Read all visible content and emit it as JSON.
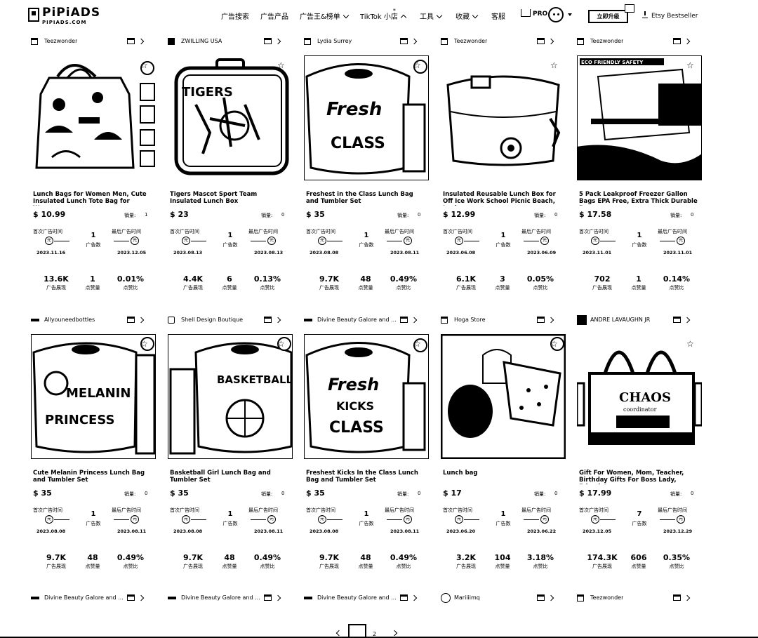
{
  "brand": {
    "name": "PiPiADS",
    "sub": "PIPIADS.COM"
  },
  "nav": [
    {
      "label": "广告搜索"
    },
    {
      "label": "广告产品"
    },
    {
      "label": "广告王&榜单"
    },
    {
      "label": "TikTok 小店",
      "badge": "*"
    },
    {
      "label": "工具"
    },
    {
      "label": "收藏"
    },
    {
      "label": "客服"
    }
  ],
  "pro_label": "PRO",
  "upgrade_label": "立即升级",
  "etsy_label": "Etsy Bestseller",
  "labels": {
    "sales": "销量:",
    "first_ad": "首次广告时间",
    "last_ad": "最后广告时间",
    "ad_count": "广告数",
    "impressions": "广告展现",
    "likes": "点赞量",
    "ctr": "点赞比"
  },
  "cards": [
    {
      "store": "Teezwonder",
      "title": "Lunch Bags for Women Men, Cute Insulated Lunch Tote Bag for Women, ...",
      "price": "$ 10.99",
      "sales": "1",
      "ads": "1",
      "first_date": "2023.11.16",
      "last_date": "2023.12.05",
      "impressions": "13.6K",
      "likes": "1",
      "ctr": "0.01%"
    },
    {
      "store": "ZWILLING USA",
      "title": "Tigers Mascot Sport Team Insulated Lunch Box",
      "price": "$ 23",
      "sales": "0",
      "ads": "1",
      "first_date": "2023.08.13",
      "last_date": "2023.08.13",
      "impressions": "4.4K",
      "likes": "6",
      "ctr": "0.13%"
    },
    {
      "store": "Lydia Surrey",
      "title": "Freshest in the Class Lunch Bag and Tumbler Set",
      "price": "$ 35",
      "sales": "0",
      "ads": "1",
      "first_date": "2023.08.08",
      "last_date": "2023.08.11",
      "impressions": "9.7K",
      "likes": "48",
      "ctr": "0.49%"
    },
    {
      "store": "Teezwonder",
      "title": "Insulated Reusable Lunch Box for Off Ice Work School Picnic Beach, Leak...",
      "price": "$ 12.99",
      "sales": "0",
      "ads": "1",
      "first_date": "2023.06.08",
      "last_date": "2023.06.09",
      "impressions": "6.1K",
      "likes": "3",
      "ctr": "0.05%"
    },
    {
      "store": "Teezwonder",
      "title": "5 Pack Leakproof Freezer Gallon Bags EPA Free, Extra Thick Durable Reus...",
      "price": "$ 17.58",
      "sales": "0",
      "ads": "1",
      "first_date": "2023.11.01",
      "last_date": "2023.11.01",
      "impressions": "702",
      "likes": "1",
      "ctr": "0.14%"
    },
    {
      "store": "Allyouneedbottles",
      "title": "Cute Melanin Princess Lunch Bag and Tumbler Set",
      "price": "$ 35",
      "sales": "0",
      "ads": "1",
      "first_date": "2023.08.08",
      "last_date": "2023.08.11",
      "impressions": "9.7K",
      "likes": "48",
      "ctr": "0.49%"
    },
    {
      "store": "Shell Design Boutique",
      "title": "Basketball Girl Lunch Bag and Tumbler Set",
      "price": "$ 35",
      "sales": "0",
      "ads": "1",
      "first_date": "2023.08.08",
      "last_date": "2023.08.11",
      "impressions": "9.7K",
      "likes": "48",
      "ctr": "0.49%"
    },
    {
      "store": "Divine Beauty Galore and ...",
      "title": "Freshest Kicks In the Class Lunch Bag and Tumbler Set",
      "price": "$ 35",
      "sales": "0",
      "ads": "1",
      "first_date": "2023.08.08",
      "last_date": "2023.08.11",
      "impressions": "9.7K",
      "likes": "48",
      "ctr": "0.49%"
    },
    {
      "store": "Hoga Store",
      "title": "Lunch bag",
      "price": "$ 17",
      "sales": "0",
      "ads": "1",
      "first_date": "2023.06.20",
      "last_date": "2023.06.22",
      "impressions": "3.2K",
      "likes": "104",
      "ctr": "3.18%"
    },
    {
      "store": "ANDRE LAVAUGHN JR",
      "title": "Gift For Women, Mom, Teacher, Birthday Gifts For Boss Lady, Friend,Cow...",
      "price": "$ 17.99",
      "sales": "0",
      "ads": "7",
      "first_date": "2023.12.05",
      "last_date": "2023.12.29",
      "impressions": "174.3K",
      "likes": "606",
      "ctr": "0.35%"
    }
  ],
  "thumb_text": {
    "tigers": "TIGERS",
    "fresh1": "Fresh",
    "fresh1b": "CLASS",
    "fresh2": "Fresh",
    "fresh2b": "KICKS",
    "fresh2c": "CLASS",
    "melanin": "MELANIN",
    "princess": "PRINCESS",
    "basketball": "BASKETBALL",
    "chaos": "CHAOS",
    "chaos_sub": "coordinator",
    "eco": "ECO FRIENDLY SAFETY"
  },
  "third_row": [
    {
      "store": "Divine Beauty Galore and ..."
    },
    {
      "store": "Divine Beauty Galore and ..."
    },
    {
      "store": "Divine Beauty Galore and ..."
    },
    {
      "store": "Mariiiimq"
    },
    {
      "store": "Teezwonder"
    }
  ],
  "pagination": {
    "prev": "‹",
    "page": "2",
    "next": "›"
  }
}
